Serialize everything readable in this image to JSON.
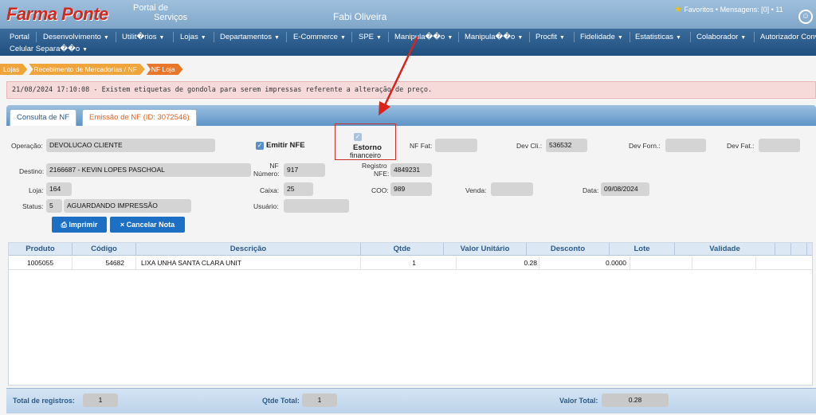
{
  "header": {
    "brand": "Farma Ponte",
    "portal_line1": "Portal de",
    "portal_line2": "Serviços",
    "user_name": "Fabi Oliveira",
    "favorites": "Favoritos",
    "messages": "Mensagens: [0]",
    "extra": "11"
  },
  "menu": {
    "items": [
      "Portal",
      "Desenvolvimento",
      "Utilit�rios",
      "Lojas",
      "Departamentos",
      "E-Commerce",
      "SPE",
      "Manipula��o",
      "Manipula��o",
      "Procfit",
      "Fidelidade",
      "Estatisticas",
      "Colaborador",
      "Autorizador Conv"
    ],
    "row2": "Celular Separa��o"
  },
  "breadcrumb": [
    "Lojas",
    "Recebimento de Mercadorias / NF",
    "NF Loja"
  ],
  "alert": "21/08/2024 17:10:08 - Existem etiquetas de gondola para serem impressas referente a alteração de preço.",
  "tabs": {
    "consulta": "Consulta de NF",
    "emissao": "Emissão de NF (ID: 3072546)"
  },
  "form": {
    "operacao_label": "Operação:",
    "operacao_value": "DEVOLUCAO CLIENTE",
    "emitir_nfe_label": "Emitir NFE",
    "estorno_label_1": "Estorno",
    "estorno_label_2": "financeiro",
    "nf_fat_label": "NF Fat:",
    "nf_fat_value": "",
    "dev_cli_label": "Dev Cli.:",
    "dev_cli_value": "536532",
    "dev_forn_label": "Dev Forn.:",
    "dev_forn_value": "",
    "dev_fat_label": "Dev Fat.:",
    "dev_fat_value": "",
    "destino_label": "Destino:",
    "destino_value": "2166687 - KEVIN LOPES PASCHOAL",
    "nf_numero_label_1": "NF",
    "nf_numero_label_2": "Número:",
    "nf_numero_value": "917",
    "registro_label_1": "Registro",
    "registro_label_2": "NFE:",
    "registro_value": "4849231",
    "loja_label": "Loja:",
    "loja_value": "164",
    "caixa_label": "Caixa:",
    "caixa_value": "25",
    "coo_label": "COO:",
    "coo_value": "989",
    "venda_label": "Venda:",
    "venda_value": "",
    "data_label": "Data:",
    "data_value": "09/08/2024",
    "status_label": "Status:",
    "status_code": "5",
    "status_value": "AGUARDANDO IMPRESSÃO",
    "usuario_label": "Usuário:",
    "usuario_value": "",
    "imprimir_label": "Imprimir",
    "cancelar_label": "Cancelar Nota"
  },
  "grid": {
    "headers": [
      "Produto",
      "Código",
      "Descrição",
      "Qtde",
      "Valor Unitário",
      "Desconto",
      "Lote",
      "Validade"
    ],
    "rows": [
      {
        "produto": "1005055",
        "codigo": "54682",
        "descricao": "LIXA UNHA SANTA CLARA UNIT",
        "qtde": "1",
        "valor_unitario": "0.28",
        "desconto": "0.0000",
        "lote": "",
        "validade": ""
      }
    ]
  },
  "footer": {
    "total_registros_label": "Total de registros:",
    "total_registros_value": "1",
    "qtde_total_label": "Qtde Total:",
    "qtde_total_value": "1",
    "valor_total_label": "Valor Total:",
    "valor_total_value": "0.28"
  },
  "colors": {
    "brand_red": "#d2281e",
    "menu_blue": "#1f4f7f",
    "breadcrumb_orange": "#f0a43c",
    "alert_bg": "#f6dada",
    "button_blue": "#1c6fc2",
    "annotation_red": "#c9302c"
  }
}
